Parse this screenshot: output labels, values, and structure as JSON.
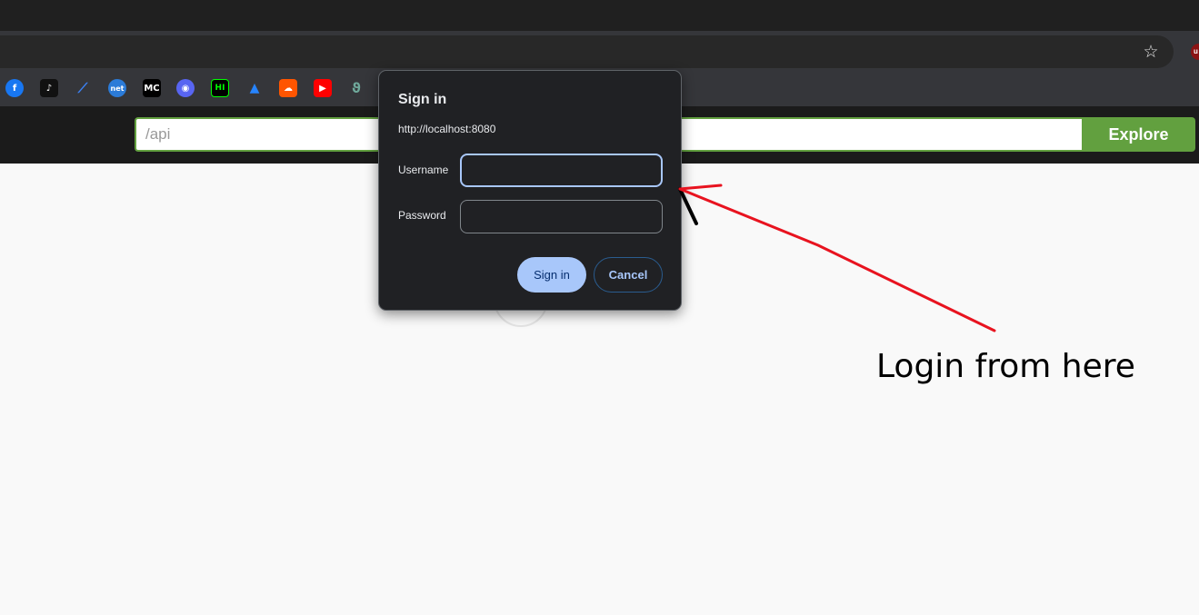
{
  "browser": {
    "bookmark_icons": [
      "facebook-icon",
      "tiktok-icon",
      "feather-icon",
      "dotnet-icon",
      "mc-icon",
      "discord-icon",
      "hackernoon-icon",
      "atlassian-icon",
      "soundcloud-icon",
      "youtube-icon",
      "leaf-icon"
    ],
    "bookmark_glyphs": [
      "f",
      "♪",
      "⟋",
      "net",
      "MC",
      "◉",
      "HI",
      "▲",
      "☁",
      "▶",
      "ϑ"
    ],
    "extension_badge": "u",
    "star_icon": "☆"
  },
  "swagger": {
    "url_value": "/api",
    "explore_label": "Explore"
  },
  "dialog": {
    "title": "Sign in",
    "origin": "http://localhost:8080",
    "username_label": "Username",
    "password_label": "Password",
    "username_value": "",
    "password_value": "",
    "sign_in_label": "Sign in",
    "cancel_label": "Cancel"
  },
  "annotation": {
    "text": "Login from here",
    "arrow_color": "#e8131f"
  },
  "colors": {
    "accent_green": "#62a03f",
    "dialog_bg": "#202124",
    "primary_button": "#a8c7fa"
  }
}
